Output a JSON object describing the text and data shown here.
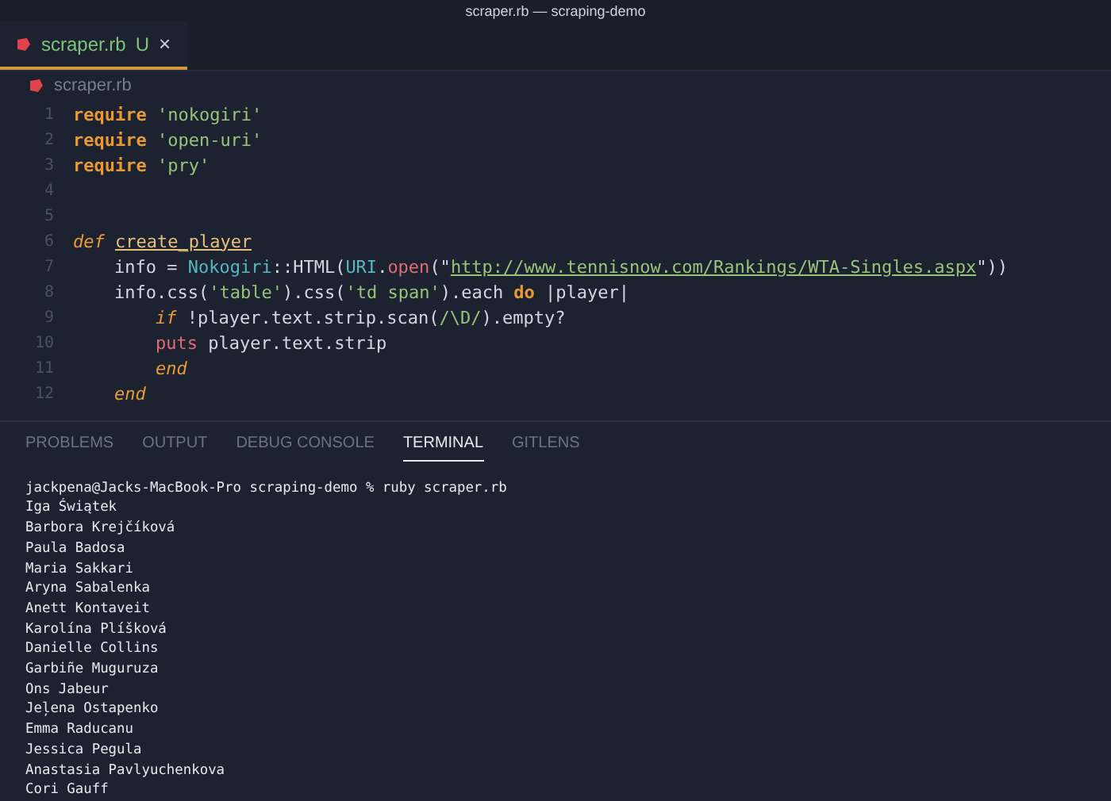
{
  "window": {
    "title": "scraper.rb — scraping-demo"
  },
  "tabs": [
    {
      "label": "scraper.rb",
      "status": "U",
      "close": "×",
      "selected": true
    }
  ],
  "breadcrumb": "scraper.rb",
  "code": [
    {
      "number": "1",
      "tokens": [
        {
          "t": "require",
          "kind": "keyword"
        },
        {
          "t": "'nokogiri'",
          "kind": "string"
        }
      ]
    },
    {
      "number": "2",
      "tokens": [
        {
          "t": "require",
          "kind": "keyword"
        },
        {
          "t": "'open-uri'",
          "kind": "string"
        }
      ]
    },
    {
      "number": "3",
      "tokens": [
        {
          "t": "require",
          "kind": "keyword"
        },
        {
          "t": "'pry'",
          "kind": "string"
        }
      ]
    },
    {
      "number": "4"
    },
    {
      "number": "5"
    },
    {
      "number": "6",
      "tokens": [
        {
          "t": "def",
          "kind": "italic"
        },
        {
          "t": "create_player",
          "kind": "function"
        }
      ],
      "children": [
        {
          "number": "7",
          "tokens": [
            {
              "t": "info =",
              "kind": "plain"
            },
            {
              "t": "Nokogiri",
              "kind": "constant"
            },
            {
              "t": "::HTML(",
              "kind": "glued"
            },
            {
              "t": "URI",
              "kind": "glued-constant"
            },
            {
              "t": ".",
              "kind": "glued"
            },
            {
              "t": "open",
              "kind": "glued-method"
            },
            {
              "t": "(\"",
              "kind": "glued"
            },
            {
              "t": "http://www.tennisnow.com/Rankings/WTA-Singles.aspx",
              "kind": "glued-url"
            },
            {
              "t": "\"))",
              "kind": "glued"
            }
          ]
        },
        {
          "number": "8",
          "tokens": [
            {
              "t": "info.css(",
              "kind": "plain"
            },
            {
              "t": "'table'",
              "kind": "glued-string"
            },
            {
              "t": ").css(",
              "kind": "glued"
            },
            {
              "t": "'td span'",
              "kind": "glued-string"
            },
            {
              "t": ").each",
              "kind": "glued"
            },
            {
              "t": "do",
              "kind": "keyword"
            },
            {
              "t": "|player|",
              "kind": "plain"
            }
          ],
          "children": [
            {
              "number": "9",
              "tokens": [
                {
                  "t": "if",
                  "kind": "italic"
                },
                {
                  "t": "!player.text.strip.scan(",
                  "kind": "plain"
                },
                {
                  "t": "/\\D/",
                  "kind": "glued-string"
                },
                {
                  "t": ").empty?",
                  "kind": "glued"
                }
              ]
            },
            {
              "number": "10",
              "tokens": [
                {
                  "t": "puts",
                  "kind": "method"
                },
                {
                  "t": "player.text.strip",
                  "kind": "plain"
                }
              ]
            },
            {
              "number": "11",
              "tokens": [
                {
                  "t": "end",
                  "kind": "italic"
                }
              ]
            }
          ]
        },
        {
          "number": "12",
          "tokens": [
            {
              "t": "end",
              "kind": "italic"
            }
          ]
        }
      ]
    }
  ],
  "panel_tabs": [
    {
      "label": "PROBLEMS",
      "selected": false
    },
    {
      "label": "OUTPUT",
      "selected": false
    },
    {
      "label": "DEBUG CONSOLE",
      "selected": false
    },
    {
      "label": "TERMINAL",
      "selected": true
    },
    {
      "label": "GITLENS",
      "selected": false
    }
  ],
  "terminal": [
    "jackpena@Jacks-MacBook-Pro scraping-demo % ruby scraper.rb",
    "Iga Świątek",
    "Barbora Krejčíková",
    "Paula Badosa",
    "Maria Sakkari",
    "Aryna Sabalenka",
    "Anett Kontaveit",
    "Karolína Plíšková",
    "Danielle Collins",
    "Garbiñe Muguruza",
    "Ons Jabeur",
    "Jeļena Ostapenko",
    "Emma Raducanu",
    "Jessica Pegula",
    "Anastasia Pavlyuchenkova",
    "Cori Gauff"
  ]
}
